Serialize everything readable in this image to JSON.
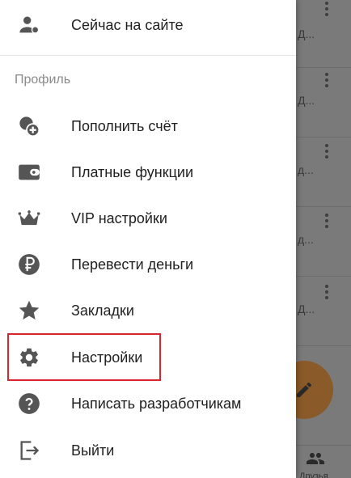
{
  "drawer": {
    "online": {
      "label": "Сейчас на сайте",
      "icon": "user-online-icon"
    },
    "section_title": "Профиль",
    "items": [
      {
        "label": "Пополнить счёт",
        "icon": "coins-add-icon"
      },
      {
        "label": "Платные функции",
        "icon": "wallet-icon"
      },
      {
        "label": "VIP настройки",
        "icon": "crown-icon"
      },
      {
        "label": "Перевести деньги",
        "icon": "ruble-icon"
      },
      {
        "label": "Закладки",
        "icon": "star-icon"
      },
      {
        "label": "Настройки",
        "icon": "gear-icon",
        "highlighted": true
      },
      {
        "label": "Написать разработчикам",
        "icon": "help-icon"
      },
      {
        "label": "Выйти",
        "icon": "logout-icon"
      }
    ]
  },
  "background": {
    "rows": [
      "Д...",
      "Д...",
      "д...",
      "д...",
      "Д..."
    ],
    "bottom_tab": "Друзья"
  },
  "colors": {
    "icon": "#555555",
    "text": "#212121",
    "section": "#8a8a8a",
    "highlight_border": "#d9262c",
    "fab": "#8a5a28"
  }
}
